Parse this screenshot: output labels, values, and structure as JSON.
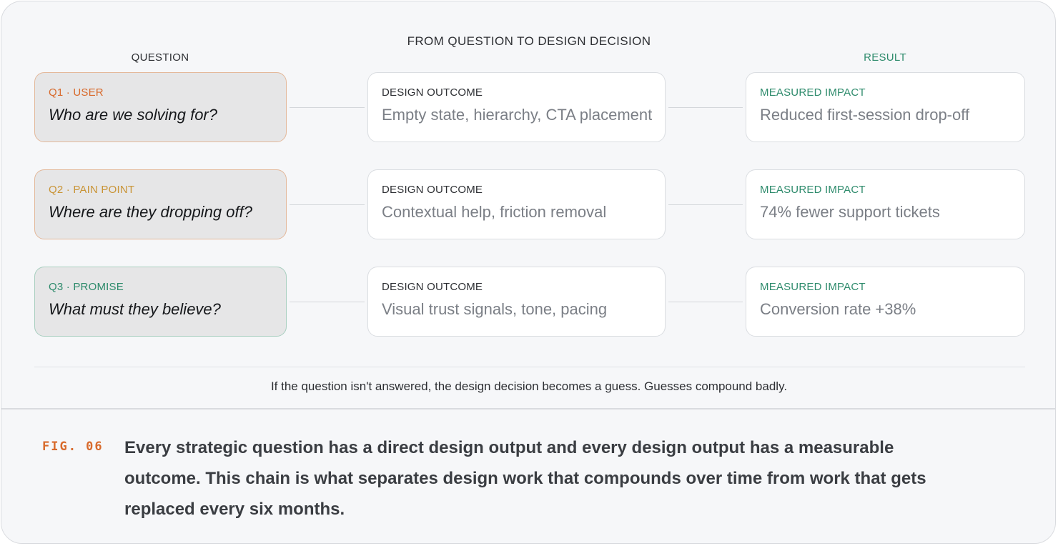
{
  "diagram": {
    "title": "FROM QUESTION TO DESIGN DECISION",
    "columns": {
      "question": "QUESTION",
      "result": "RESULT"
    },
    "rows": [
      {
        "question_tag": "Q1 · USER",
        "question": "Who are we solving for?",
        "outcome_tag": "DESIGN OUTCOME",
        "outcome": "Empty state, hierarchy, CTA placement",
        "impact_tag": "MEASURED IMPACT",
        "impact": "Reduced first-session drop-off"
      },
      {
        "question_tag": "Q2 · PAIN POINT",
        "question": "Where are they dropping off?",
        "outcome_tag": "DESIGN OUTCOME",
        "outcome": "Contextual help, friction removal",
        "impact_tag": "MEASURED IMPACT",
        "impact": "74% fewer support tickets"
      },
      {
        "question_tag": "Q3 · PROMISE",
        "question": "What must they believe?",
        "outcome_tag": "DESIGN OUTCOME",
        "outcome": "Visual trust signals, tone, pacing",
        "impact_tag": "MEASURED IMPACT",
        "impact": "Conversion rate +38%"
      }
    ],
    "footnote": "If the question isn't answered, the design decision becomes a guess. Guesses compound badly."
  },
  "caption": {
    "label": "FIG. 06",
    "text": "Every strategic question has a direct design output and every design output has a measurable outcome. This chain is what separates design work that compounds over time from work that gets replaced every six months."
  },
  "colors": {
    "user": "#d86a2c",
    "pain_point": "#c99436",
    "promise": "#2e8b6c",
    "result": "#2e8b6c"
  }
}
